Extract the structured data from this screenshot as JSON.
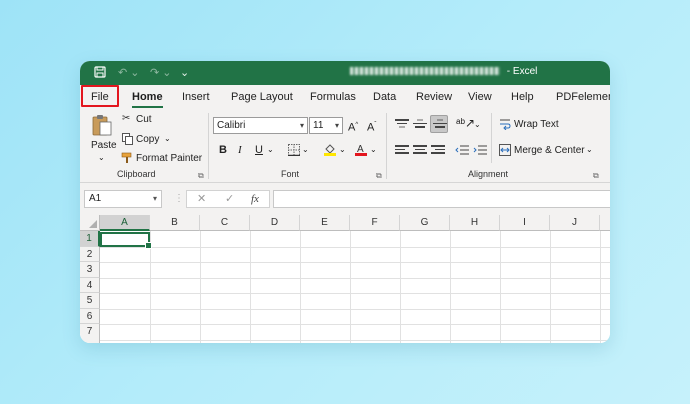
{
  "titlebar": {
    "app_name": "Excel",
    "separator": "-",
    "qa_save": "💾",
    "qa_undo": "↶ ⌄",
    "qa_redo": "↷ ⌄",
    "qa_more": "⌄"
  },
  "tabs": [
    {
      "label": "File"
    },
    {
      "label": "Home"
    },
    {
      "label": "Insert"
    },
    {
      "label": "Page Layout"
    },
    {
      "label": "Formulas"
    },
    {
      "label": "Data"
    },
    {
      "label": "Review"
    },
    {
      "label": "View"
    },
    {
      "label": "Help"
    },
    {
      "label": "PDFelement"
    }
  ],
  "clipboard": {
    "paste": "Paste",
    "paste_arrow": "⌄",
    "cut": "Cut",
    "copy": "Copy",
    "copy_arrow": "⌄",
    "format_painter": "Format Painter",
    "label": "Clipboard"
  },
  "font": {
    "name": "Calibri",
    "size": "11",
    "grow": "A^",
    "shrink": "A˅",
    "bold": "B",
    "italic": "I",
    "underline": "U",
    "underline_arrow": "⌄",
    "label": "Font",
    "fill_color": "#ffe600",
    "font_color": "#e3161e"
  },
  "alignment": {
    "wrap_text": "Wrap Text",
    "merge_center": "Merge & Center",
    "merge_arrow": "⌄",
    "label": "Alignment"
  },
  "formula_bar": {
    "name_box": "A1",
    "cancel": "✕",
    "enter": "✓",
    "fx": "fx",
    "value": ""
  },
  "grid": {
    "columns": [
      "A",
      "B",
      "C",
      "D",
      "E",
      "F",
      "G",
      "H",
      "I",
      "J"
    ],
    "rows": [
      "1",
      "2",
      "3",
      "4",
      "5",
      "6",
      "7"
    ],
    "active_cell": "A1"
  },
  "colors": {
    "accent": "#217346",
    "highlight": "#e3161e"
  }
}
